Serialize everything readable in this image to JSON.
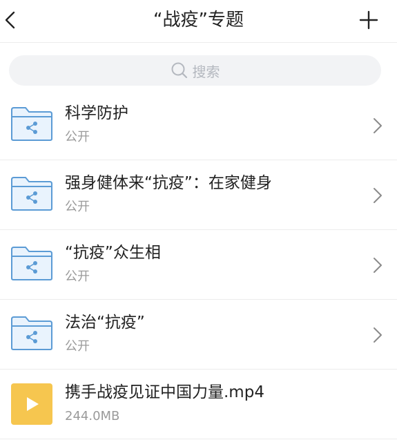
{
  "header": {
    "title": "“战疫”专题",
    "back_icon": "chevron-left-icon",
    "add_icon": "plus-icon"
  },
  "search": {
    "placeholder": "搜索",
    "icon": "search-icon"
  },
  "colors": {
    "folder_stroke": "#5b9bd5",
    "folder_fill": "#e9f3fd",
    "video_bg": "#f6c64f",
    "subtext": "#9a9a9a"
  },
  "items": [
    {
      "name": "科学防护",
      "meta": "公开",
      "type": "shared-folder"
    },
    {
      "name": "强身健体来“抗疫”：在家健身",
      "meta": "公开",
      "type": "shared-folder"
    },
    {
      "name": "“抗疫”众生相",
      "meta": "公开",
      "type": "shared-folder"
    },
    {
      "name": "法治“抗疫”",
      "meta": "公开",
      "type": "shared-folder"
    },
    {
      "name": "携手战疫见证中国力量.mp4",
      "meta": "244.0MB",
      "type": "video"
    }
  ]
}
